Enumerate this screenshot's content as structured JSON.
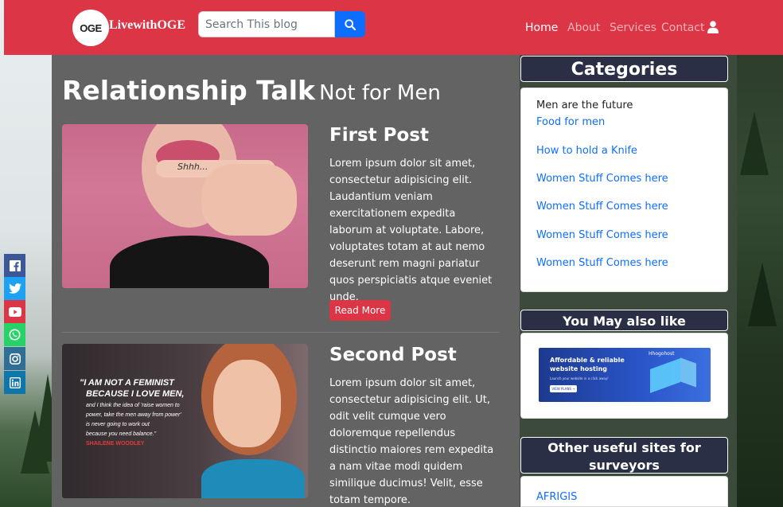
{
  "navbar": {
    "logo_text": "OGE",
    "brand": "LivewithOGE",
    "search_placeholder": "Search This blog",
    "links": [
      {
        "label": "Home",
        "active": true
      },
      {
        "label": "About",
        "active": false
      },
      {
        "label": "Services",
        "active": false
      },
      {
        "label": "Contact",
        "active": false
      }
    ]
  },
  "main": {
    "title_bold": "Relationship Talk",
    "title_light": "Not for Men",
    "posts": [
      {
        "title": "First Post",
        "body": "Lorem ipsum dolor sit amet, consectetur adipisicing elit. Laudantium veniam exercitationem expedita laborum at voluptate. Labore, voluptates totam at aut nemo deserunt rem magni pariatur quos perspiciatis atque eveniet unde.",
        "button": "Read More",
        "image_text": "Shhh..."
      },
      {
        "title": "Second Post",
        "body": "Lorem ipsum dolor sit amet, consectetur adipisicing elit. Ut, odit velit cumque vero doloremque repellendus distinctio maiores rem expedita a nam vitae modi quidem similique ducimus! Velit, esse totam tempore.",
        "quote_line1": "\"I AM NOT A FEMINIST",
        "quote_line2": "BECAUSE I LOVE MEN,",
        "quote_line3": "and I think the idea of 'raise women to",
        "quote_line4": "power, take the men away from power'",
        "quote_line5": "is never going to work out",
        "quote_line6": "because you need balance.\"",
        "quote_author": "SHAILENE WOODLEY"
      }
    ]
  },
  "sidebar": {
    "categories_title": "Categories",
    "categories_intro": "Men are the future",
    "categories": [
      "Food for men",
      "How to hold a Knife",
      "Women Stuff Comes here",
      "Women Stuff Comes here",
      "Women Stuff Comes here",
      "Women Stuff Comes here"
    ],
    "also_like_title": "You May also like",
    "ad": {
      "brand": "Hhogohost",
      "headline1": "Affordable & reliable",
      "headline2": "website hosting",
      "sub": "Launch your website in a click away!",
      "cta": "VIEW PLANS →"
    },
    "useful_title": "Other useful sites for surveyors",
    "useful_sites": [
      "AFRIGIS"
    ]
  },
  "social": [
    {
      "name": "facebook",
      "color": "#3b5998"
    },
    {
      "name": "twitter",
      "color": "#1da1f2"
    },
    {
      "name": "youtube",
      "color": "#dc3545"
    },
    {
      "name": "whatsapp",
      "color": "#25d366"
    },
    {
      "name": "instagram",
      "color": "#2f6f96"
    },
    {
      "name": "linkedin",
      "color": "#0e76a8"
    }
  ]
}
